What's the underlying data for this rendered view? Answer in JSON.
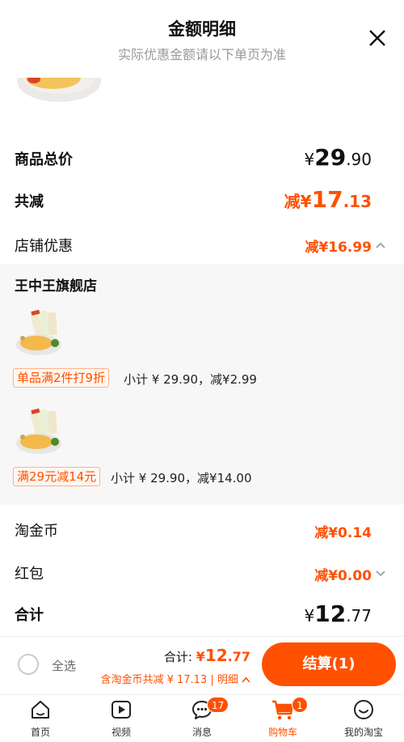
{
  "header": {
    "title": "金额明细",
    "subtitle": "实际优惠金额请以下单页为准"
  },
  "summary": {
    "goods_total_label": "商品总价",
    "goods_total": {
      "currency": "¥",
      "int": "29",
      "dec": ".90"
    },
    "discount_total_label": "共减",
    "discount_total": {
      "prefix": "减¥",
      "int": "17",
      "dec": ".13"
    },
    "shop_discount_label": "店铺优惠",
    "shop_discount": "减¥16.99"
  },
  "shop": {
    "name": "王中王旗舰店",
    "items": [
      {
        "tag": "单品满2件打9折",
        "subtotal": "小计 ¥ 29.90，减¥2.99"
      },
      {
        "tag": "满29元减14元",
        "subtotal": "小计 ¥ 29.90，减¥14.00"
      }
    ]
  },
  "extras": {
    "coins_label": "淘金币",
    "coins_value": "减¥0.14",
    "redpack_label": "红包",
    "redpack_value": "减¥0.00",
    "total_label": "合计",
    "total": {
      "currency": "¥",
      "int": "12",
      "dec": ".77"
    }
  },
  "checkout_bar": {
    "select_all": "全选",
    "total_label": "合计: ",
    "total_currency": "¥",
    "total_int": "12",
    "total_dec": ".77",
    "detail_text": "含淘金币共减 ¥ 17.13 | 明细",
    "checkout_label": "结算(1)"
  },
  "tabs": [
    {
      "label": "首页",
      "icon": "home-icon"
    },
    {
      "label": "视频",
      "icon": "video-icon"
    },
    {
      "label": "消息",
      "icon": "message-icon",
      "badge": "17"
    },
    {
      "label": "购物车",
      "icon": "cart-icon",
      "badge": "1",
      "active": true
    },
    {
      "label": "我的淘宝",
      "icon": "profile-icon"
    }
  ],
  "colors": {
    "accent": "#ff5000",
    "panel": "#f7f7f7",
    "muted": "#999999"
  }
}
